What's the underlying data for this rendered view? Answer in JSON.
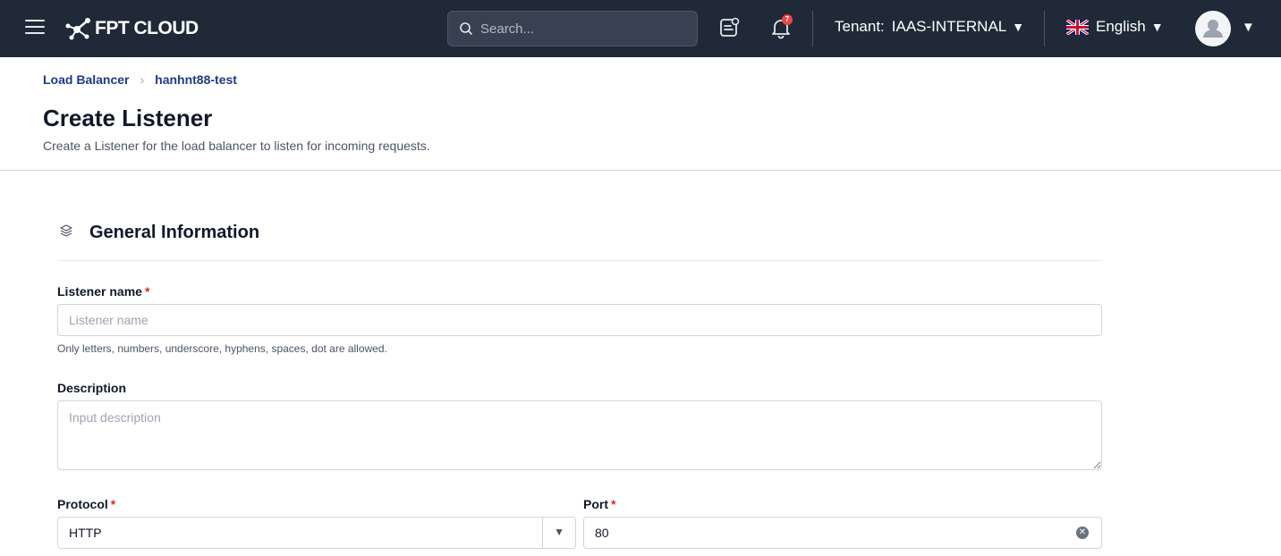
{
  "topbar": {
    "logo_text": "FPT CLOUD",
    "search_placeholder": "Search...",
    "notification_count": "7",
    "tenant_label": "Tenant:",
    "tenant_value": "IAAS-INTERNAL",
    "language": "English",
    "colors": {
      "background": "#1f2937",
      "badge": "#ef4444"
    }
  },
  "breadcrumb": {
    "items": [
      "Load Balancer",
      "hanhnt88-test"
    ]
  },
  "header": {
    "title": "Create Listener",
    "subtitle": "Create a Listener for the load balancer to listen for incoming requests."
  },
  "section": {
    "title": "General Information"
  },
  "form": {
    "listener_name": {
      "label": "Listener name",
      "required_mark": "*",
      "placeholder": "Listener name",
      "value": "",
      "hint": "Only letters, numbers, underscore, hyphens, spaces, dot are allowed."
    },
    "description": {
      "label": "Description",
      "placeholder": "Input description",
      "value": ""
    },
    "protocol": {
      "label": "Protocol",
      "required_mark": "*",
      "value": "HTTP"
    },
    "port": {
      "label": "Port",
      "required_mark": "*",
      "value": "80"
    }
  }
}
